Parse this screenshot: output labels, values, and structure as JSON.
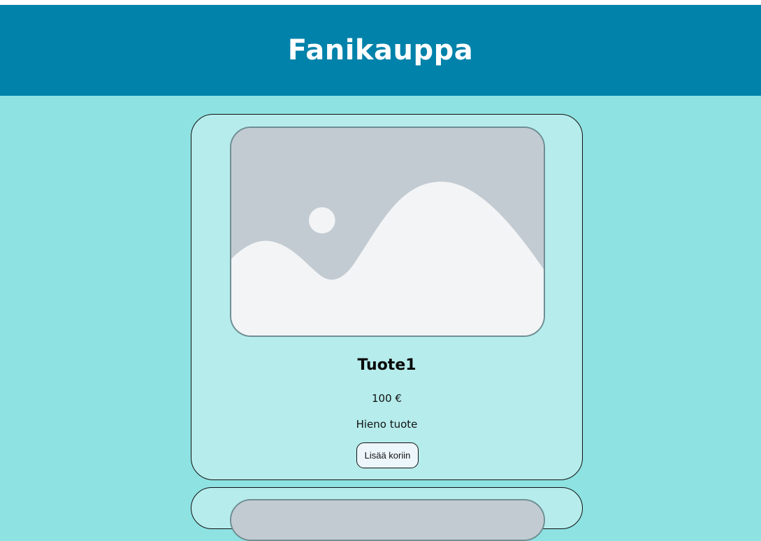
{
  "header": {
    "title": "Fanikauppa"
  },
  "products": [
    {
      "name": "Tuote1",
      "price": "100 €",
      "description": "Hieno tuote",
      "button_label": "Lisää koriin",
      "image_icon": "image-placeholder-icon"
    },
    {
      "image_icon": "image-placeholder-icon"
    }
  ],
  "colors": {
    "page_background": "#8ee2e2",
    "header_background": "#0082aa",
    "card_background": "#b6ecec",
    "placeholder_sky": "#c3cbd2",
    "placeholder_hills": "#f2f4f6",
    "button_background": "#ecf6fb"
  }
}
